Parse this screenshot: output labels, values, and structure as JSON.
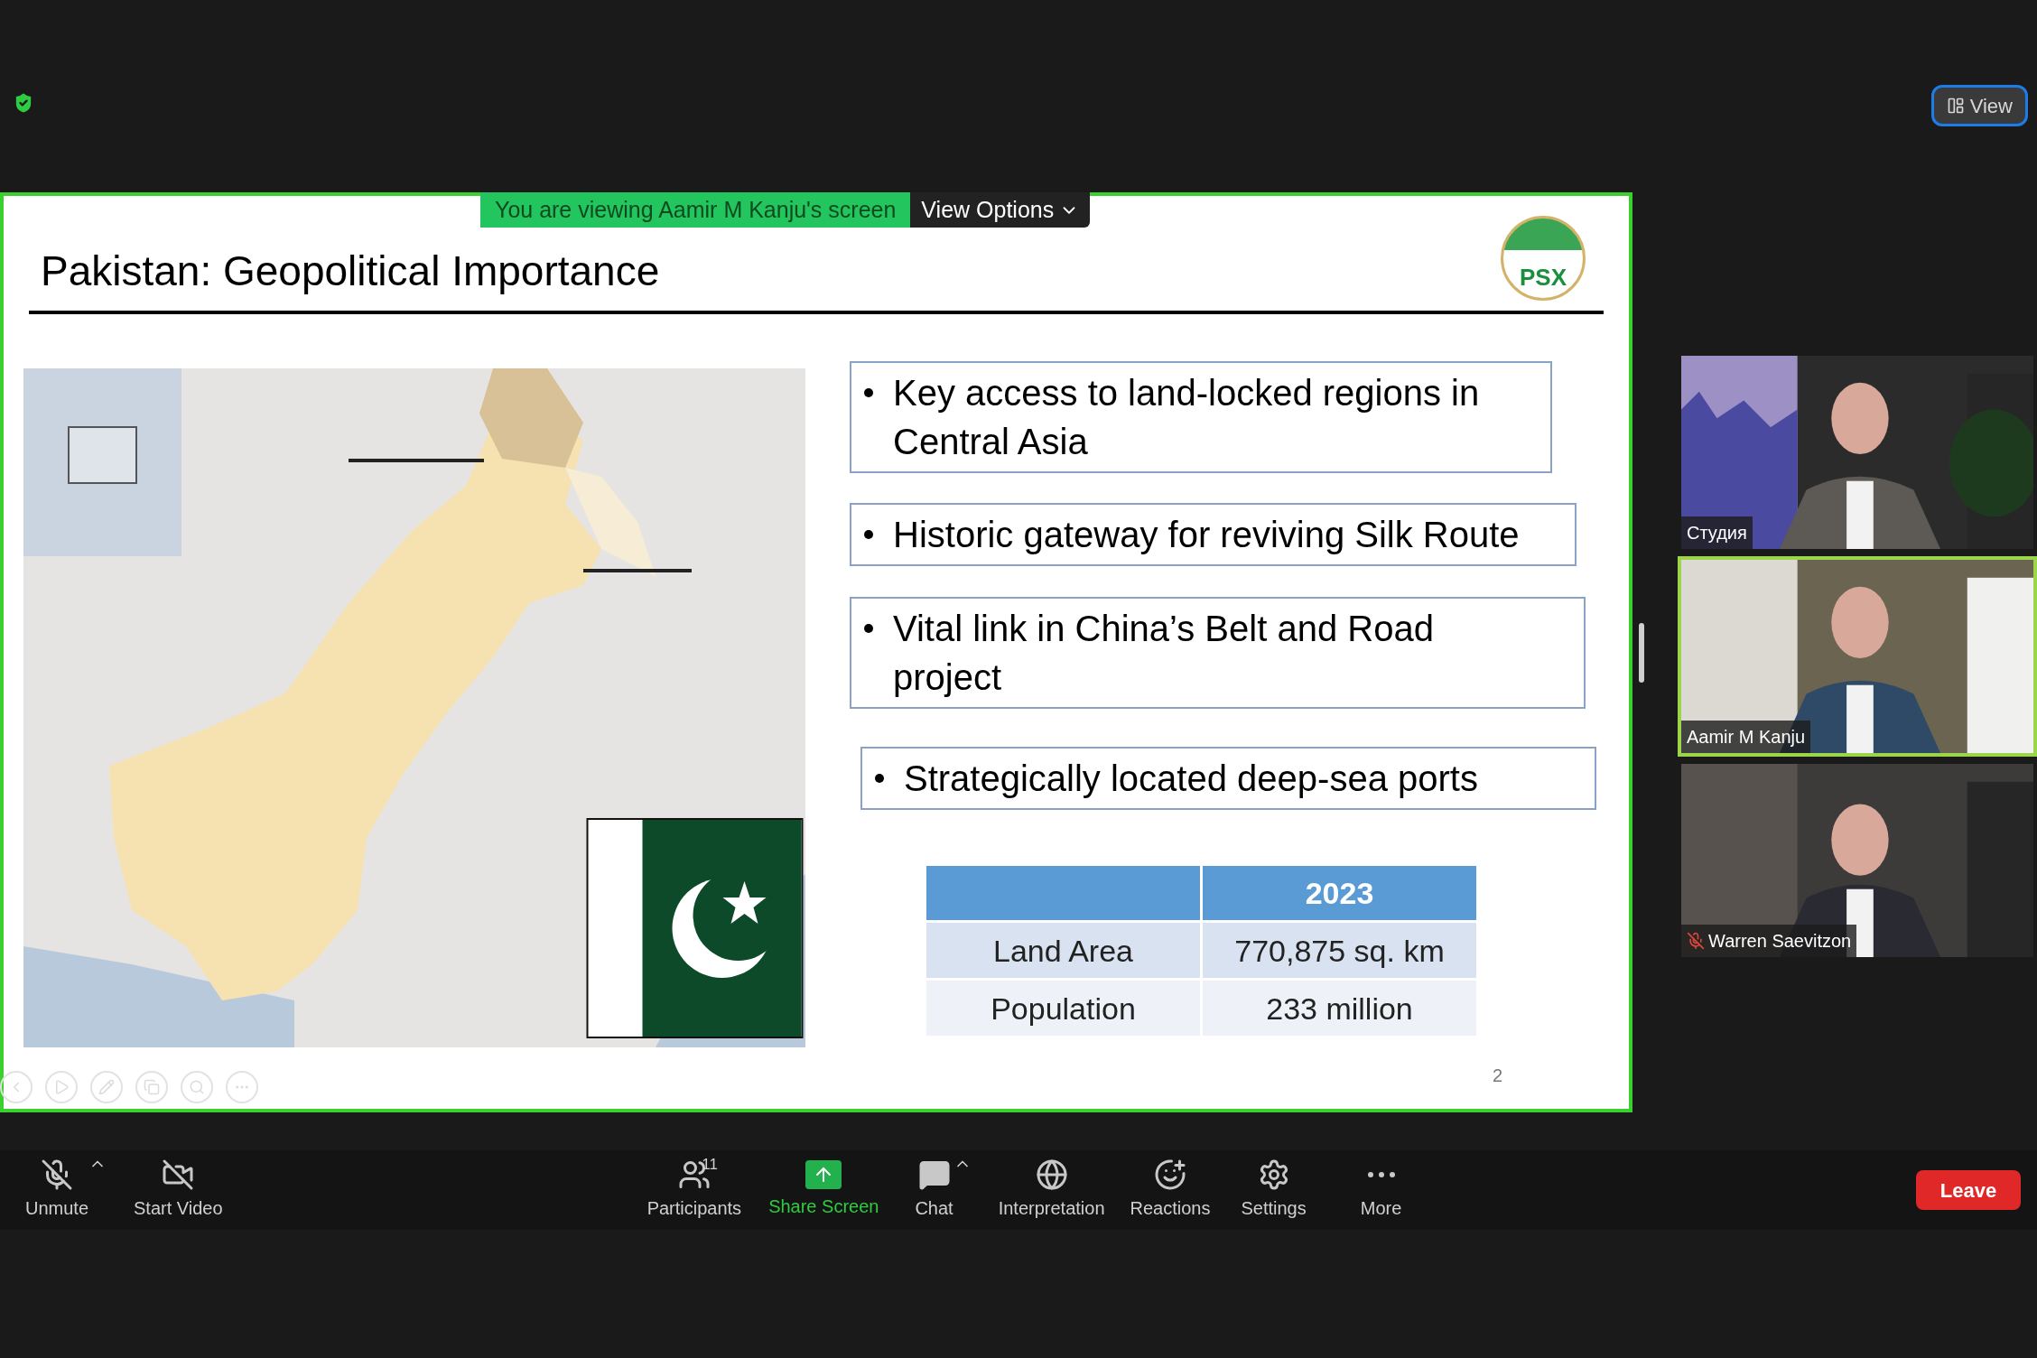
{
  "top_bar": {
    "view_button": "View"
  },
  "share_banner": {
    "text": "You are viewing Aamir M Kanju's screen",
    "options": "View Options"
  },
  "slide": {
    "title": "Pakistan: Geopolitical Importance",
    "logo": "PSX",
    "bullets": [
      "Key access to land-locked regions in Central Asia",
      "Historic gateway for reviving Silk Route",
      "Vital link in China’s Belt and Road project",
      "Strategically located deep-sea ports"
    ],
    "table": {
      "columns": [
        "2023"
      ],
      "rows": [
        {
          "label": "Land Area",
          "value": "770,875 sq. km"
        },
        {
          "label": "Population",
          "value": "233 million"
        }
      ]
    },
    "page_number": "2"
  },
  "participants": [
    {
      "name": "Студия",
      "muted": false,
      "selected": false
    },
    {
      "name": "Aamir M Kanju",
      "muted": false,
      "selected": true
    },
    {
      "name": "Warren Saevitzon",
      "muted": true,
      "selected": false
    }
  ],
  "toolbar": [
    {
      "kind": "mic",
      "label": "Unmute"
    },
    {
      "kind": "video",
      "label": "Start Video"
    },
    {
      "kind": "participants",
      "label": "Participants",
      "badge": "11"
    },
    {
      "kind": "share",
      "label": "Share Screen"
    },
    {
      "kind": "chat",
      "label": "Chat"
    },
    {
      "kind": "interpretation",
      "label": "Interpretation"
    },
    {
      "kind": "reactions",
      "label": "Reactions"
    },
    {
      "kind": "settings",
      "label": "Settings"
    },
    {
      "kind": "more",
      "label": "More"
    }
  ],
  "leave_button": "Leave"
}
